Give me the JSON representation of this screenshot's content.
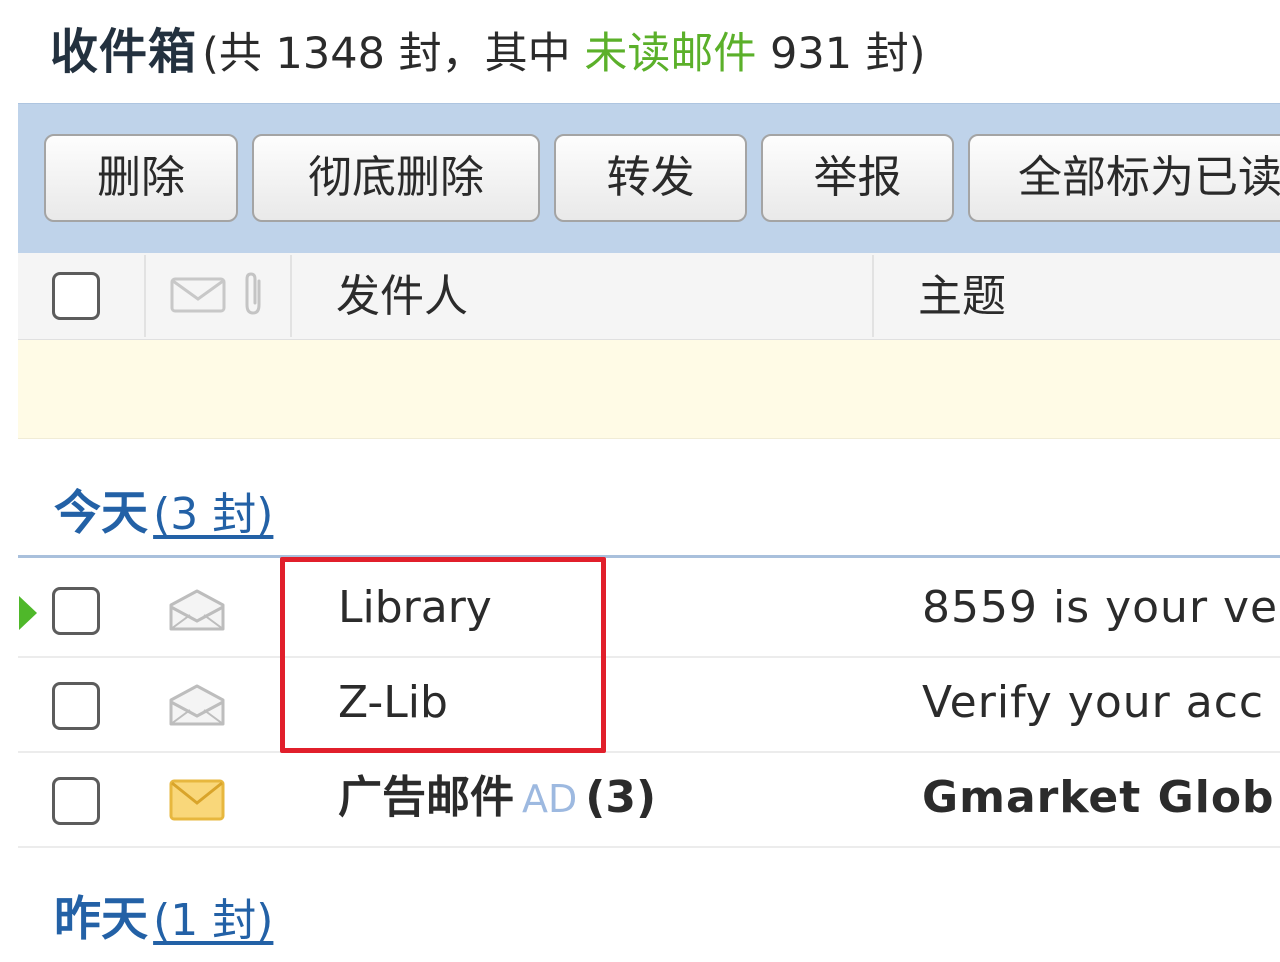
{
  "header": {
    "folder": "收件箱",
    "count_prefix": "(共 1348 封，其中 ",
    "unread_link": "未读邮件",
    "count_suffix": " 931 封)"
  },
  "toolbar": {
    "delete": "删除",
    "permanent_delete": "彻底删除",
    "forward": "转发",
    "report": "举报",
    "mark_all_read": "全部标为已读"
  },
  "columns": {
    "sender": "发件人",
    "subject": "主题"
  },
  "groups": {
    "today": {
      "label": "今天",
      "count": "(3 封)"
    },
    "yesterday": {
      "label": "昨天",
      "count": "(1 封)"
    }
  },
  "rows": [
    {
      "sender": "Library",
      "subject": "8559 is your ve",
      "unread": false
    },
    {
      "sender": "Z-Lib",
      "subject": "Verify your acc",
      "unread": false
    },
    {
      "sender": "广告邮件",
      "ad_tag": "AD",
      "ad_count": "(3)",
      "subject": "Gmarket Glob",
      "unread": true
    }
  ],
  "colors": {
    "unread_green": "#5bb02a",
    "group_blue": "#2361a6",
    "toolbar_bg": "#bfd3ea",
    "highlight_red": "#e11f2b"
  }
}
